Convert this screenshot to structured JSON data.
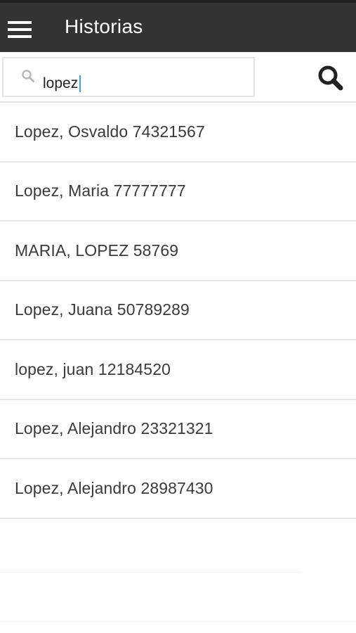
{
  "app_bar": {
    "title": "Historias",
    "menu_icon": "hamburger-menu-icon",
    "background": "#333333"
  },
  "search": {
    "value": "lopez",
    "placeholder_icon": "search-icon",
    "button_icon": "search-icon"
  },
  "results": [
    {
      "label": "Lopez, Osvaldo 74321567"
    },
    {
      "label": "Lopez, Maria 77777777"
    },
    {
      "label": "MARIA, LOPEZ 58769"
    },
    {
      "label": "Lopez, Juana 50789289"
    },
    {
      "label": "lopez, juan 12184520"
    },
    {
      "label": "Lopez, Alejandro 23321321"
    },
    {
      "label": "Lopez, Alejandro 28987430"
    }
  ]
}
